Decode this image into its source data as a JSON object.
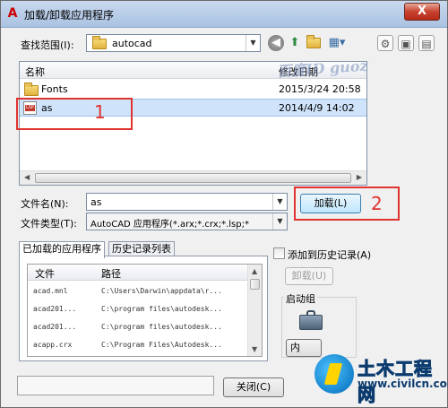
{
  "window": {
    "title": "加载/卸载应用程序",
    "close_label": "X",
    "app_icon": "A"
  },
  "lookin": {
    "label": "查找范围(I):",
    "value": "autocad"
  },
  "toolbar": {
    "icons": [
      "back-icon",
      "up-folder-icon",
      "new-folder-icon",
      "views-menu-icon"
    ]
  },
  "file_list": {
    "columns": [
      "名称",
      "修改日期"
    ],
    "rows": [
      {
        "name": "Fonts",
        "date": "2015/3/24 20:58",
        "type": "folder"
      },
      {
        "name": "as",
        "date": "2014/4/9 14:02",
        "type": "lsp"
      }
    ]
  },
  "filename": {
    "label": "文件名(N):",
    "value": "as"
  },
  "filetype": {
    "label": "文件类型(T):",
    "value": "AutoCAD 应用程序(*.arx;*.crx;*.lsp;*"
  },
  "buttons": {
    "load": "加载(L)",
    "unload": "卸载(U)",
    "close": "关闭(C)",
    "content_partial": "内"
  },
  "annotations": {
    "mark1": "1",
    "mark2": "2"
  },
  "tabs": [
    {
      "label": "已加载的应用程序",
      "active": true
    },
    {
      "label": "历史记录列表",
      "active": false
    }
  ],
  "loaded_apps": {
    "columns": [
      "文件",
      "路径"
    ],
    "rows": [
      {
        "file": "acad.mnl",
        "path": "C:\\Users\\Darwin\\appdata\\r..."
      },
      {
        "file": "acad201...",
        "path": "C:\\program files\\autodesk..."
      },
      {
        "file": "acad201...",
        "path": "C:\\program files\\autodesk..."
      },
      {
        "file": "acapp.crx",
        "path": "C:\\Program Files\\Autodesk..."
      }
    ]
  },
  "history_checkbox": {
    "label": "添加到历史记录(A)",
    "checked": false
  },
  "startup_group": {
    "label": "启动组"
  },
  "watermark": "百度ID guoz",
  "brand": {
    "name": "土木工程网",
    "url": "www.civilcn.com"
  }
}
